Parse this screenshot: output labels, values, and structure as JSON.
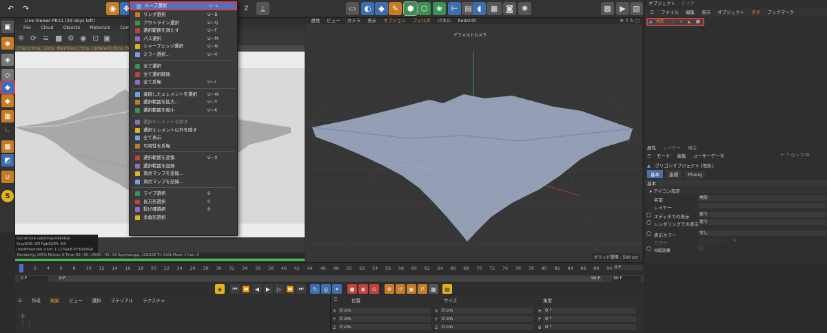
{
  "top_toolbar": {
    "left_icons": [
      "undo-icon",
      "redo-icon",
      "live-selection-icon",
      "move-icon"
    ],
    "center_icons": [
      "render-region-icon",
      "render-view-icon",
      "cube-icon",
      "pen-icon",
      "subdivision-icon",
      "cloner-icon",
      "mograph-icon",
      "deformer-icon",
      "floor-icon",
      "camera-icon",
      "light-icon"
    ],
    "right_icons": [
      "render-settings-icon",
      "render-picture-icon",
      "edit-render-icon"
    ]
  },
  "live_viewer": {
    "title": "Live Viewer PR11 (29 days left)",
    "menu": [
      "File",
      "Cloud",
      "Objects",
      "Materials",
      "Compare",
      "C"
    ],
    "status": "Check:0ms, 12ms. MeshGen:13ms. Update(0):9ms. Render",
    "stats": [
      "Out-of-core used/max:0Kb/4Gb",
      "Grey8/16: 0/0        Rgb32/64: 0/0",
      "Used/free/total vram: 1.127Gb/6.873Gb/8Gb"
    ],
    "bottom": "Rendering: 100%   Ms/sec: 0   Time: 00 : 00 : 00/00 : 00 : 00   Spp/maxspp: 128/128   Tri: 520k   Mesh: 1   Hair: 0",
    "progress": 1.0
  },
  "viewport": {
    "menu": [
      "透視",
      "ビュー",
      "カメラ",
      "表示",
      "オプション",
      "フィルタ",
      "パネル",
      "Redshift"
    ],
    "camera_label": "デフォルトカメラ",
    "grid_label": "グリッド間隔 : 500 cm"
  },
  "object_manager": {
    "tabs": [
      "オブジェクト",
      "テイク"
    ],
    "menu": [
      "ファイル",
      "編集",
      "表示",
      "オブジェクト",
      "タグ",
      "ブックマーク"
    ],
    "object_name": "地形"
  },
  "attributes": {
    "tabs": [
      "属性",
      "レイヤー",
      "構造"
    ],
    "menu": [
      "モード",
      "編集",
      "ユーザーデータ"
    ],
    "object_title": "ポリゴンオブジェクト [地形]",
    "sub_tabs": [
      "基本",
      "座標",
      "Phong"
    ],
    "section": "基本",
    "group": "▸ アイコン設定",
    "fields": [
      {
        "label": "名前",
        "value": "地形"
      },
      {
        "label": "レイヤー",
        "value": ""
      },
      {
        "label": "エディタでの表示",
        "value": "従う"
      },
      {
        "label": "レンダリングでの表示",
        "value": "従う"
      },
      {
        "label": "表示カラー",
        "value": "なし"
      },
      {
        "label": "カラー",
        "value": ""
      },
      {
        "label": "X線効果",
        "value": ""
      }
    ]
  },
  "timeline": {
    "ticks": [
      "0",
      "2",
      "4",
      "6",
      "8",
      "10",
      "12",
      "14",
      "16",
      "18",
      "20",
      "22",
      "24",
      "26",
      "28",
      "30",
      "32",
      "34",
      "36",
      "38",
      "40",
      "42",
      "44",
      "46",
      "48",
      "50",
      "52",
      "54",
      "56",
      "58",
      "60",
      "62",
      "64",
      "66",
      "68",
      "70",
      "72",
      "74",
      "76",
      "78",
      "80",
      "82",
      "84",
      "86",
      "88",
      "90"
    ],
    "frame_right": "0 F",
    "start": "0 F",
    "current": "0 F",
    "end": "90 F",
    "end2": "90 F"
  },
  "bottom_menu": [
    "作成",
    "編集",
    "ビュー",
    "選択",
    "マテリアル",
    "テクスチャ"
  ],
  "coordinates": {
    "headers": [
      "位置",
      "サイズ",
      "角度"
    ],
    "rows": [
      {
        "axis": "X",
        "pos": "0 cm",
        "size_axis": "X",
        "size": "0 cm",
        "rot_axis": "H",
        "rot": "0 °"
      },
      {
        "axis": "Y",
        "pos": "0 cm",
        "size_axis": "Y",
        "size": "0 cm",
        "rot_axis": "P",
        "rot": "0 °"
      },
      {
        "axis": "Z",
        "pos": "0 cm",
        "size_axis": "Z",
        "size": "0 cm",
        "rot_axis": "B",
        "rot": "0 °"
      }
    ]
  },
  "context_menu": {
    "items": [
      {
        "label": "ループ選択",
        "shortcut": "U~L",
        "selected": true
      },
      {
        "label": "リング選択",
        "shortcut": "U~B"
      },
      {
        "label": "アウトライン選択",
        "shortcut": "U~Q"
      },
      {
        "label": "選択範囲を満たす",
        "shortcut": "U~F"
      },
      {
        "label": "パス選択",
        "shortcut": "U~M"
      },
      {
        "label": "シャープエッジ選択",
        "shortcut": "U~N"
      },
      {
        "label": "ミラー選択...",
        "shortcut": "U~V"
      },
      {
        "sep": true
      },
      {
        "label": "全て選択",
        "shortcut": ""
      },
      {
        "label": "全て選択解除",
        "shortcut": ""
      },
      {
        "label": "全て反転",
        "shortcut": "U~I"
      },
      {
        "sep": true
      },
      {
        "label": "連続したエレメントを選択",
        "shortcut": "U~W"
      },
      {
        "label": "選択範囲を拡大...",
        "shortcut": "U~Y"
      },
      {
        "label": "選択範囲を縮小",
        "shortcut": "U~K"
      },
      {
        "sep": true
      },
      {
        "label": "選択エレメントを隠す",
        "shortcut": "",
        "disabled": true
      },
      {
        "label": "選択エレメント以外を隠す",
        "shortcut": ""
      },
      {
        "label": "全て表示",
        "shortcut": ""
      },
      {
        "label": "可視性を反転",
        "shortcut": ""
      },
      {
        "sep": true
      },
      {
        "label": "選択範囲を変換",
        "shortcut": "U~X"
      },
      {
        "label": "選択範囲を記録",
        "shortcut": ""
      },
      {
        "label": "頂点マップを変換...",
        "shortcut": ""
      },
      {
        "label": "頂点マップを記録...",
        "shortcut": ""
      },
      {
        "sep": true
      },
      {
        "label": "ライブ選択",
        "shortcut": "9"
      },
      {
        "label": "長方形選択",
        "shortcut": "0"
      },
      {
        "label": "投げ縄選択",
        "shortcut": "8"
      },
      {
        "label": "多角形選択",
        "shortcut": ""
      }
    ]
  },
  "colors": {
    "accent": "#e79a2c",
    "selection": "#4b70c6",
    "highlight_box": "#e23c3c"
  }
}
